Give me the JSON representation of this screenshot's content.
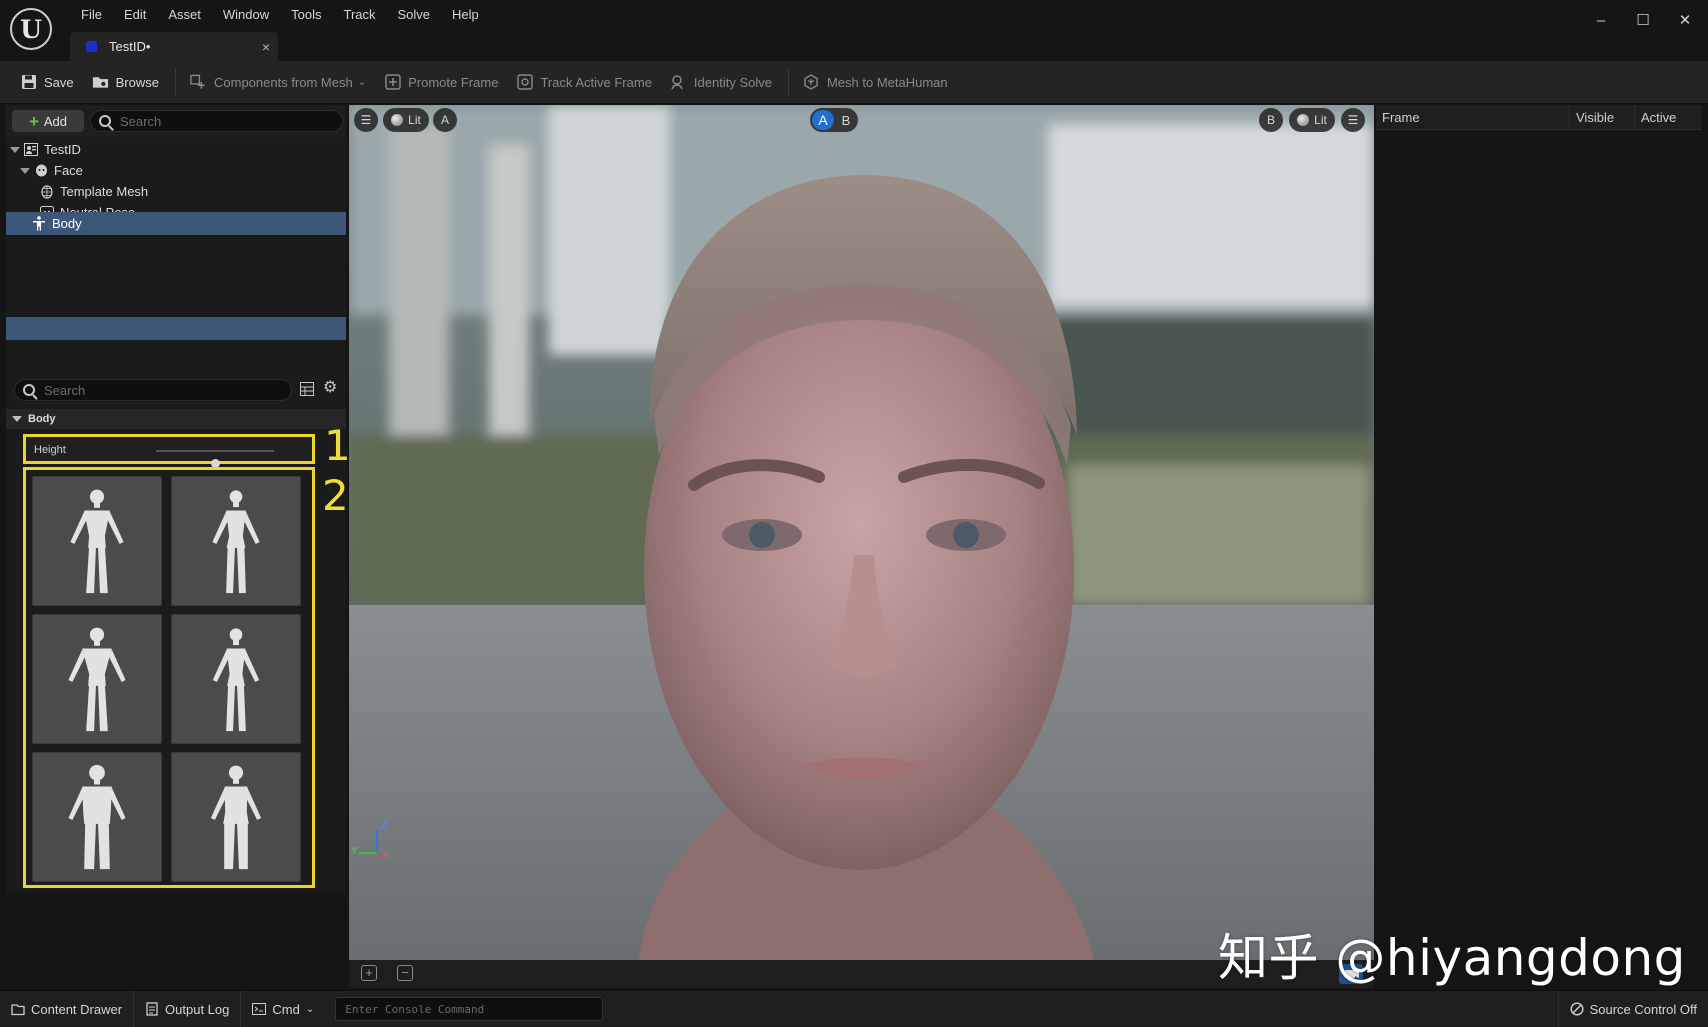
{
  "window": {
    "menu": [
      "File",
      "Edit",
      "Asset",
      "Window",
      "Tools",
      "Track",
      "Solve",
      "Help"
    ],
    "tab_title": "TestID•",
    "tab_close": "×",
    "minimize": "–",
    "maximize": "☐",
    "close": "✕",
    "logo_letter": "U"
  },
  "toolbar": {
    "save": "Save",
    "browse": "Browse",
    "components_from_mesh": "Components from Mesh",
    "promote_frame": "Promote Frame",
    "track_active_frame": "Track Active Frame",
    "identity_solve": "Identity Solve",
    "mesh_to_metahuman": "Mesh to MetaHuman"
  },
  "outliner": {
    "add_label": "Add",
    "search_placeholder": "Search",
    "items": [
      {
        "label": "TestID",
        "icon": "identity-icon"
      },
      {
        "label": "Face",
        "icon": "face-icon"
      },
      {
        "label": "Template Mesh",
        "icon": "mesh-icon"
      },
      {
        "label": "Neutral Pose",
        "icon": "pose-icon"
      },
      {
        "label": "Body",
        "icon": "body-icon",
        "selected": true
      }
    ]
  },
  "details": {
    "search_placeholder": "Search",
    "section": "Body",
    "height_label": "Height",
    "height_value": 0.5,
    "annotation_1": "1",
    "annotation_2": "2",
    "presets": [
      "male-average",
      "female-average",
      "male-athletic",
      "female-slim",
      "male-heavy",
      "female-heavy"
    ]
  },
  "viewport": {
    "menu_left": "☰",
    "lit_left": "Lit",
    "channel_a": "A",
    "ab_a": "A",
    "ab_b": "B",
    "channel_b": "B",
    "lit_right": "Lit",
    "menu_right": "☰",
    "axis_z": "Z",
    "axis_x": "X",
    "axis_y": "Y"
  },
  "frame_panel": {
    "columns": [
      "Frame",
      "Visible",
      "Active"
    ]
  },
  "statusbar": {
    "content_drawer": "Content Drawer",
    "output_log": "Output Log",
    "cmd": "Cmd",
    "console_placeholder": "Enter Console Command",
    "source_control": "Source Control Off"
  },
  "watermark": "知乎 @hiyangdong",
  "colors": {
    "accent_selected": "#3c5777",
    "annotation_yellow": "#ecd52b",
    "ab_active": "#1f6fd1",
    "add_plus": "#6ec13d"
  }
}
